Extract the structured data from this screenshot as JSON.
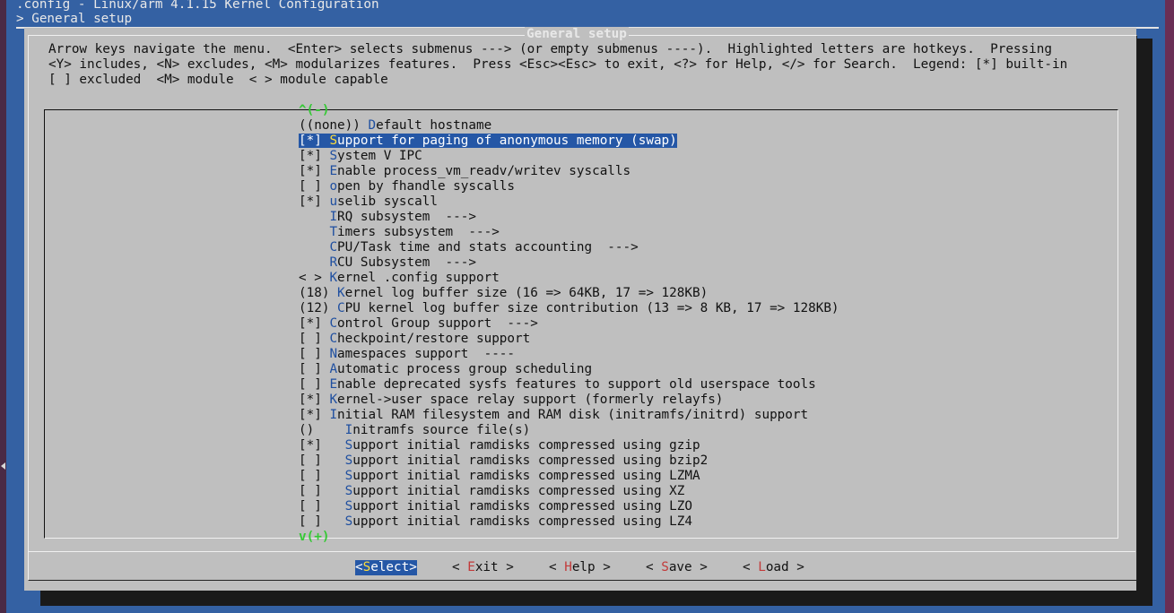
{
  "window": {
    "title": ".config - Linux/arm 4.1.15 Kernel Configuration",
    "breadcrumb": "> General setup"
  },
  "dialog": {
    "title": "General setup",
    "help_lines": [
      "Arrow keys navigate the menu.  <Enter> selects submenus ---> (or empty submenus ----).  Highlighted letters are hotkeys.  Pressing",
      "<Y> includes, <N> excludes, <M> modularizes features.  Press <Esc><Esc> to exit, <?> for Help, </> for Search.  Legend: [*] built-in",
      "[ ] excluded  <M> module  < > module capable"
    ],
    "scroll_up": "^(-)",
    "scroll_down": "v(+)"
  },
  "menu_items": [
    {
      "prefix": "((none)) ",
      "hotkey": "D",
      "rest": "efault hostname"
    },
    {
      "prefix": "[*] ",
      "hotkey": "S",
      "rest": "upport for paging of anonymous memory (swap)"
    },
    {
      "prefix": "[*] ",
      "hotkey": "S",
      "rest": "ystem V IPC"
    },
    {
      "prefix": "[*] ",
      "hotkey": "E",
      "rest": "nable process_vm_readv/writev syscalls"
    },
    {
      "prefix": "[ ] ",
      "hotkey": "o",
      "rest": "pen by fhandle syscalls"
    },
    {
      "prefix": "[*] ",
      "hotkey": "u",
      "rest": "selib syscall"
    },
    {
      "prefix": "    ",
      "hotkey": "I",
      "rest": "RQ subsystem  --->"
    },
    {
      "prefix": "    ",
      "hotkey": "T",
      "rest": "imers subsystem  --->"
    },
    {
      "prefix": "    ",
      "hotkey": "C",
      "rest": "PU/Task time and stats accounting  --->"
    },
    {
      "prefix": "    ",
      "hotkey": "R",
      "rest": "CU Subsystem  --->"
    },
    {
      "prefix": "< > ",
      "hotkey": "K",
      "rest": "ernel .config support"
    },
    {
      "prefix": "(18) ",
      "hotkey": "K",
      "rest": "ernel log buffer size (16 => 64KB, 17 => 128KB)"
    },
    {
      "prefix": "(12) ",
      "hotkey": "C",
      "rest": "PU kernel log buffer size contribution (13 => 8 KB, 17 => 128KB)"
    },
    {
      "prefix": "[*] ",
      "hotkey": "C",
      "rest": "ontrol Group support  --->"
    },
    {
      "prefix": "[ ] ",
      "hotkey": "C",
      "rest": "heckpoint/restore support"
    },
    {
      "prefix": "[ ] ",
      "hotkey": "N",
      "rest": "amespaces support  ----"
    },
    {
      "prefix": "[ ] ",
      "hotkey": "A",
      "rest": "utomatic process group scheduling"
    },
    {
      "prefix": "[ ] ",
      "hotkey": "E",
      "rest": "nable deprecated sysfs features to support old userspace tools"
    },
    {
      "prefix": "[*] ",
      "hotkey": "K",
      "rest": "ernel->user space relay support (formerly relayfs)"
    },
    {
      "prefix": "[*] ",
      "hotkey": "I",
      "rest": "nitial RAM filesystem and RAM disk (initramfs/initrd) support"
    },
    {
      "prefix": "()    ",
      "hotkey": "I",
      "rest": "nitramfs source file(s)"
    },
    {
      "prefix": "[*]   ",
      "hotkey": "S",
      "rest": "upport initial ramdisks compressed using gzip"
    },
    {
      "prefix": "[ ]   ",
      "hotkey": "S",
      "rest": "upport initial ramdisks compressed using bzip2"
    },
    {
      "prefix": "[ ]   ",
      "hotkey": "S",
      "rest": "upport initial ramdisks compressed using LZMA"
    },
    {
      "prefix": "[ ]   ",
      "hotkey": "S",
      "rest": "upport initial ramdisks compressed using XZ"
    },
    {
      "prefix": "[ ]   ",
      "hotkey": "S",
      "rest": "upport initial ramdisks compressed using LZO"
    },
    {
      "prefix": "[ ]   ",
      "hotkey": "S",
      "rest": "upport initial ramdisks compressed using LZ4"
    }
  ],
  "buttons": [
    {
      "pre": "<",
      "hotkey": "S",
      "post": "elect>",
      "selected": true
    },
    {
      "pre": "< ",
      "hotkey": "E",
      "post": "xit >",
      "selected": false
    },
    {
      "pre": "< ",
      "hotkey": "H",
      "post": "elp >",
      "selected": false
    },
    {
      "pre": "< ",
      "hotkey": "S",
      "post": "ave >",
      "selected": false
    },
    {
      "pre": "< ",
      "hotkey": "L",
      "post": "oad >",
      "selected": false
    }
  ],
  "colors": {
    "terminal_bg": "#3461a3",
    "dialog_bg": "#bfbfbf",
    "highlight_bg": "#2557a6",
    "menu_hotkey": "#1f4fa0",
    "button_hotkey": "#c23a3a",
    "scroll_indicator": "#36c936"
  }
}
